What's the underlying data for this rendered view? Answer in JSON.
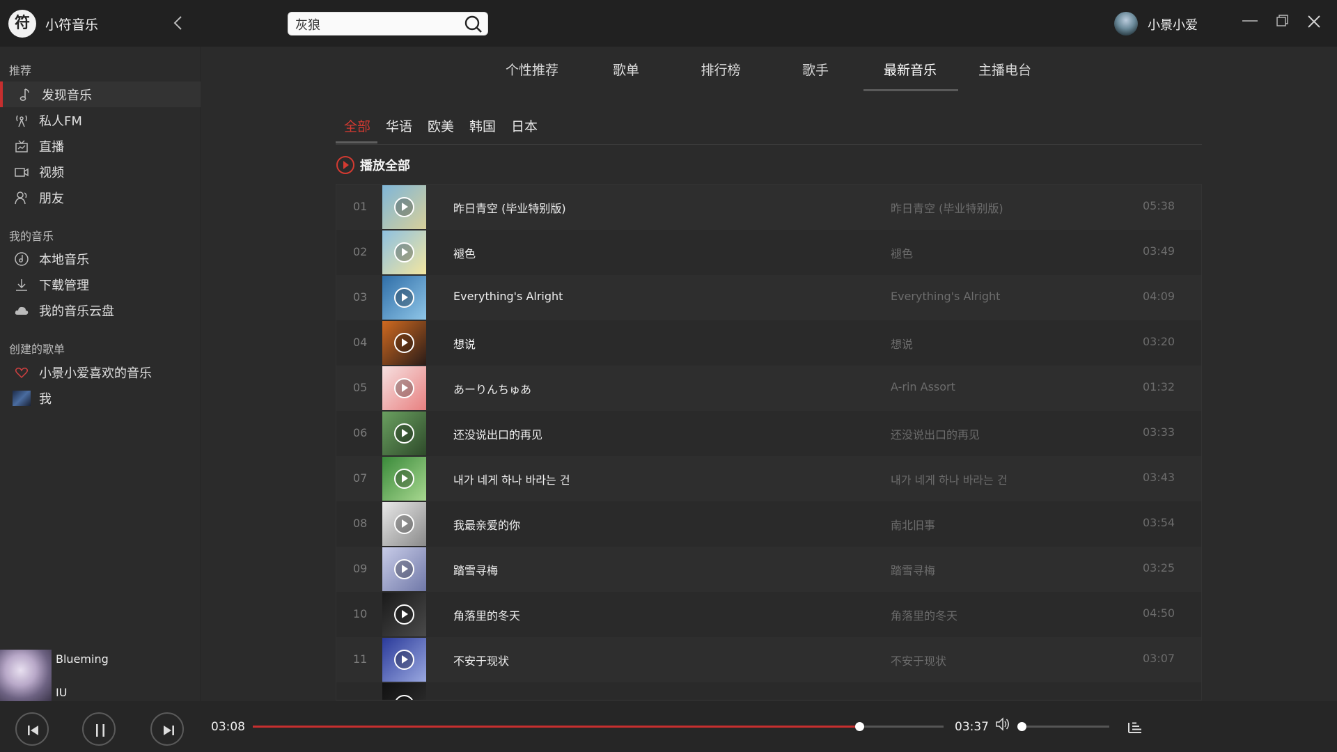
{
  "app": {
    "logo_char": "符",
    "name": "小符音乐"
  },
  "search": {
    "value": "灰狼",
    "placeholder": ""
  },
  "user": {
    "name": "小景小爱"
  },
  "sidebar": {
    "section_recommend": "推荐",
    "recommend_items": [
      {
        "label": "发现音乐",
        "icon": "music-note-icon",
        "active": true
      },
      {
        "label": "私人FM",
        "icon": "radio-icon"
      },
      {
        "label": "直播",
        "icon": "live-icon"
      },
      {
        "label": "视频",
        "icon": "video-icon"
      },
      {
        "label": "朋友",
        "icon": "friends-icon"
      }
    ],
    "section_my_music": "我的音乐",
    "my_music_items": [
      {
        "label": "本地音乐",
        "icon": "local-music-icon"
      },
      {
        "label": "下载管理",
        "icon": "download-icon"
      },
      {
        "label": "我的音乐云盘",
        "icon": "cloud-icon"
      }
    ],
    "section_playlists": "创建的歌单",
    "playlist_items": [
      {
        "label": "小景小爱喜欢的音乐",
        "icon": "heart-icon"
      },
      {
        "label": "我",
        "icon": "playlist-cover"
      }
    ]
  },
  "now_playing": {
    "title": "Blueming",
    "artist": "IU"
  },
  "main_tabs": [
    {
      "label": "个性推荐"
    },
    {
      "label": "歌单"
    },
    {
      "label": "排行榜"
    },
    {
      "label": "歌手"
    },
    {
      "label": "最新音乐",
      "active": true
    },
    {
      "label": "主播电台"
    }
  ],
  "sub_tabs": [
    {
      "label": "全部",
      "active": true
    },
    {
      "label": "华语"
    },
    {
      "label": "欧美"
    },
    {
      "label": "韩国"
    },
    {
      "label": "日本"
    }
  ],
  "play_all_label": "播放全部",
  "songs": [
    {
      "no": "01",
      "title": "昨日青空 (毕业特别版)",
      "album": "昨日青空 (毕业特别版)",
      "duration": "05:38",
      "cover": [
        "#7fb6d8",
        "#d8d09a"
      ]
    },
    {
      "no": "02",
      "title": "褪色",
      "album": "褪色",
      "duration": "03:49",
      "cover": [
        "#8ec0e0",
        "#f3e6a0"
      ]
    },
    {
      "no": "03",
      "title": "Everything's Alright",
      "album": "Everything's Alright",
      "duration": "04:09",
      "cover": [
        "#2f6ea8",
        "#8fc6e8"
      ]
    },
    {
      "no": "04",
      "title": "想说",
      "album": "想说",
      "duration": "03:20",
      "cover": [
        "#d06a20",
        "#2a1c18"
      ]
    },
    {
      "no": "05",
      "title": "あーりんちゅあ",
      "album": "A-rin Assort",
      "duration": "01:32",
      "cover": [
        "#f6e0e0",
        "#e88080"
      ]
    },
    {
      "no": "06",
      "title": "还没说出口的再见",
      "album": "还没说出口的再见",
      "duration": "03:33",
      "cover": [
        "#6aa060",
        "#2e4a2a"
      ]
    },
    {
      "no": "07",
      "title": "내가 네게 하나 바라는 건",
      "album": "내가 네게 하나 바라는 건",
      "duration": "03:43",
      "cover": [
        "#3a8a3a",
        "#a8d890"
      ]
    },
    {
      "no": "08",
      "title": "我最亲爱的你",
      "album": "南北旧事",
      "duration": "03:54",
      "cover": [
        "#e8e8e8",
        "#8a8a8a"
      ]
    },
    {
      "no": "09",
      "title": "踏雪寻梅",
      "album": "踏雪寻梅",
      "duration": "03:25",
      "cover": [
        "#c8cce8",
        "#7078a8"
      ]
    },
    {
      "no": "10",
      "title": "角落里的冬天",
      "album": "角落里的冬天",
      "duration": "04:50",
      "cover": [
        "#1a1a1a",
        "#4a4a4a"
      ]
    },
    {
      "no": "11",
      "title": "不安于现状",
      "album": "不安于现状",
      "duration": "03:07",
      "cover": [
        "#2a3a9a",
        "#9aa8e0"
      ]
    },
    {
      "no": "",
      "title": "",
      "album": "",
      "duration": "",
      "cover": [
        "#111111",
        "#333333"
      ]
    }
  ],
  "player": {
    "current_time": "03:08",
    "total_time": "03:37",
    "progress": 0.878,
    "volume": 0.0
  },
  "colors": {
    "accent": "#c62f2f",
    "background": "#2b2b2b",
    "titlebar": "#212121"
  }
}
